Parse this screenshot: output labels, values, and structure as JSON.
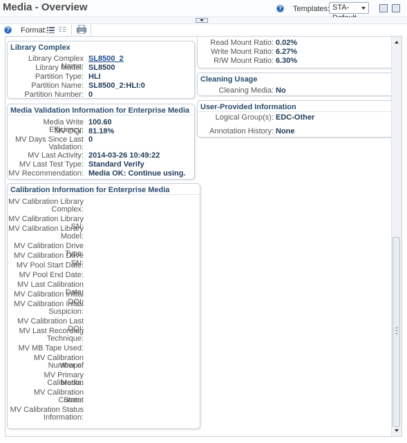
{
  "header": {
    "title": "Media - Overview",
    "templates_label": "Templates:",
    "templates_value": "STA-Default"
  },
  "toolbar": {
    "format_label": "Format:"
  },
  "library_complex": {
    "title": "Library Complex",
    "rows": [
      {
        "label": "Library Complex Name:",
        "value": "SL8500_2",
        "link": true
      },
      {
        "label": "Library Model:",
        "value": "SL8500"
      },
      {
        "label": "Partition Type:",
        "value": "HLI"
      },
      {
        "label": "Partition Name:",
        "value": "SL8500_2:HLI:0"
      },
      {
        "label": "Partition Number:",
        "value": "0"
      }
    ]
  },
  "media_validation": {
    "title": "Media Validation Information for Enterprise Media",
    "rows": [
      {
        "label": "Media Write Efficiency:",
        "value": "100.60"
      },
      {
        "label": "MV DQI:",
        "value": "81.18%"
      },
      {
        "label": "MV Days Since Last",
        "label2": "Validation:",
        "value": "0"
      },
      {
        "label": "MV Last Activity:",
        "value": "2014-03-26 10:49:22"
      },
      {
        "label": "MV Last Test Type:",
        "value": "Standard Verify"
      },
      {
        "label": "MV Recommendation:",
        "value": "Media OK: Continue using."
      }
    ]
  },
  "calibration": {
    "title": "Calibration Information for Enterprise Media",
    "rows": [
      {
        "label": "MV Calibration Library",
        "label2": "Complex:"
      },
      {
        "label": "MV Calibration Library SN:"
      },
      {
        "label": "MV Calibration Library",
        "label2": "Model:"
      },
      {
        "label": "MV Calibration Drive Type:"
      },
      {
        "label": "MV Calibration Drive SN:"
      },
      {
        "label": "MV Pool Start Date:"
      },
      {
        "label": "MV Pool End Date:"
      },
      {
        "label": "MV Last Calibration Date:"
      },
      {
        "label": "MV Calibration Initial DQI:"
      },
      {
        "label": "MV Calibration Initial",
        "label2": "Suspicion:"
      },
      {
        "label": "MV Calibration Last DQI:"
      },
      {
        "label": "MV Last Recording",
        "label2": "Technique:"
      },
      {
        "label": "MV MB Tape Used:"
      },
      {
        "label": "MV Calibration Number of",
        "label2": "Wraps:"
      },
      {
        "label": "MV Primary Calibration",
        "label2": "Media:"
      },
      {
        "label": "MV Calibration Current",
        "label2": "State:"
      },
      {
        "label": "MV Calibration Status",
        "label2": "Information:"
      }
    ]
  },
  "mount_ratios": {
    "rows": [
      {
        "label": "Read Mount Ratio:",
        "value": "0.02%"
      },
      {
        "label": "Write Mount Ratio:",
        "value": "6.27%"
      },
      {
        "label": "R/W Mount Ratio:",
        "value": "6.30%"
      }
    ]
  },
  "cleaning_usage": {
    "title": "Cleaning Usage",
    "rows": [
      {
        "label": "Cleaning Media:",
        "value": "No"
      }
    ]
  },
  "user_provided": {
    "title": "User-Provided Information",
    "rows": [
      {
        "label": "Logical Group(s):",
        "value": "EDC-Other"
      },
      {
        "label": "Annotation History:",
        "value": "None"
      }
    ]
  }
}
